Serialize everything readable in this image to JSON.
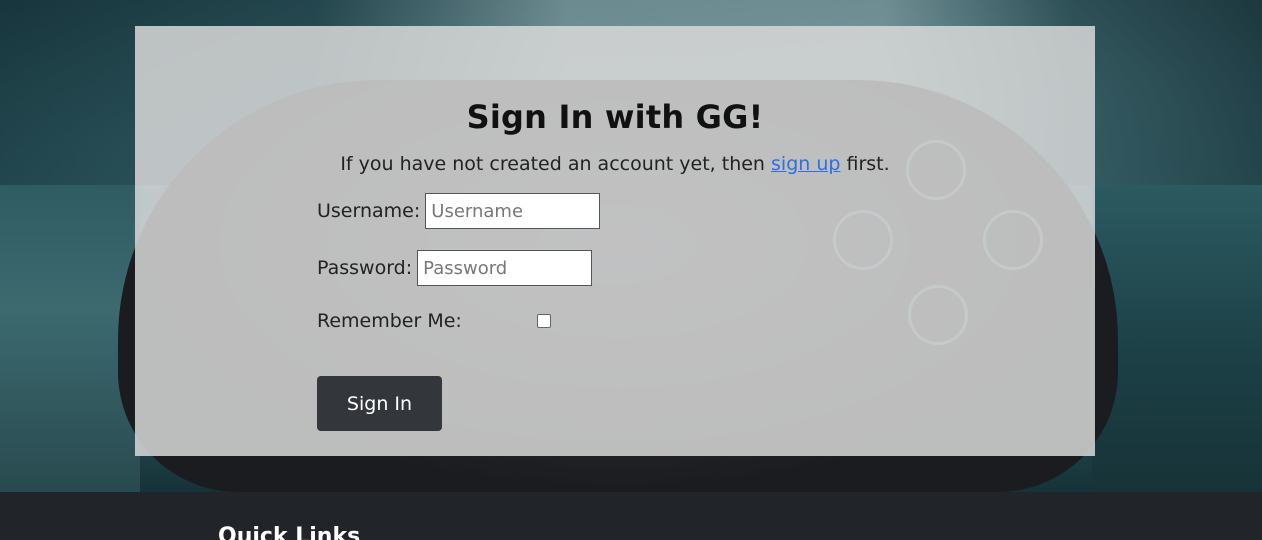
{
  "signin": {
    "title": "Sign In with GG!",
    "subtitle_pre": "If you have not created an account yet, then ",
    "subtitle_link": "sign up",
    "subtitle_post": " first.",
    "username_label": "Username:",
    "username_placeholder": "Username",
    "password_label": "Password:",
    "password_placeholder": "Password",
    "remember_label": "Remember Me:",
    "remember_checked": false,
    "submit_label": "Sign In"
  },
  "footer": {
    "heading": "Quick Links"
  },
  "colors": {
    "link": "#2f6fe0",
    "button": "#33363b",
    "footer": "#212428",
    "card": "#d7d7d7"
  }
}
